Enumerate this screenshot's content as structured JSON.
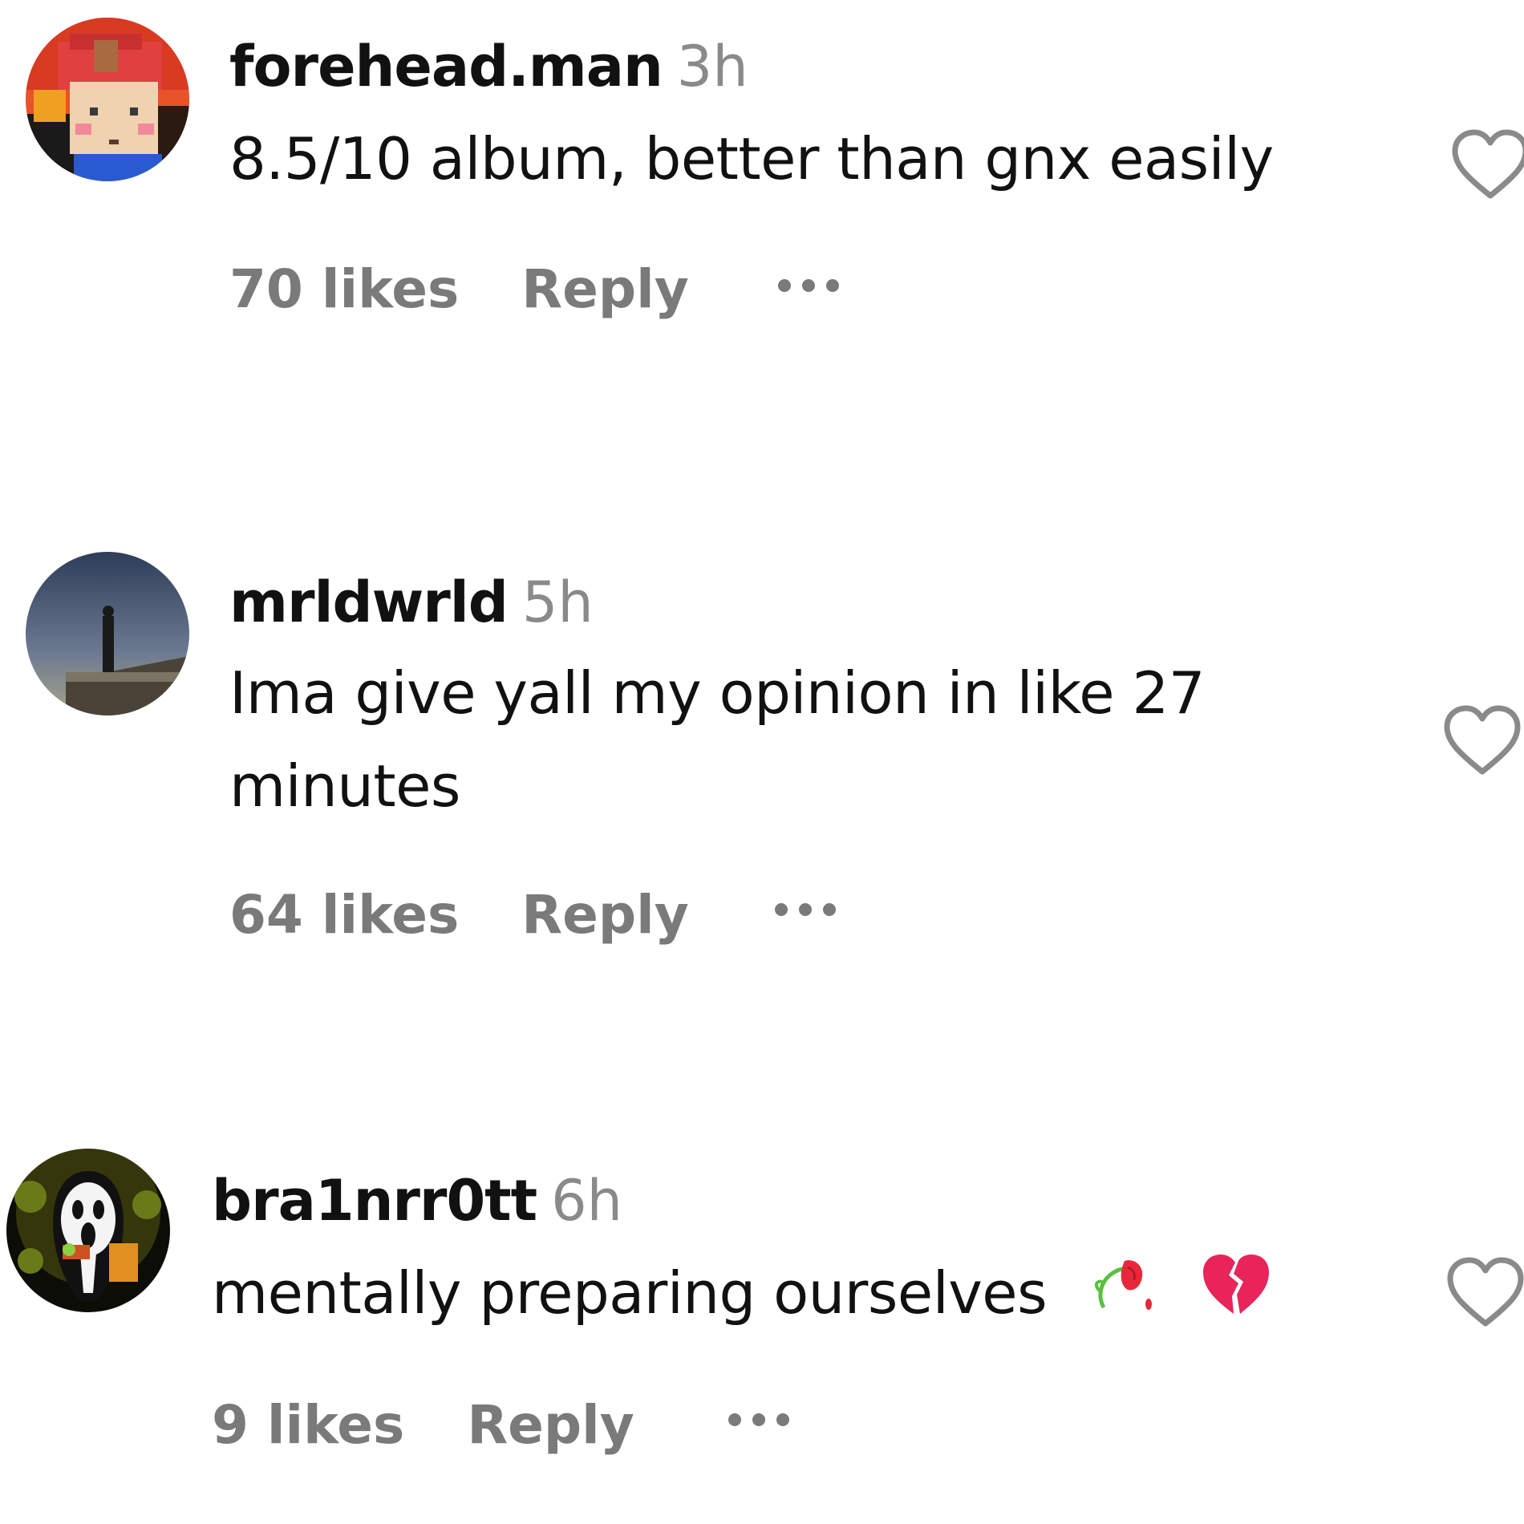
{
  "comments": [
    {
      "username": "forehead.man",
      "time": "3h",
      "text": "8.5/10 album, better than gnx easily",
      "likes": "70 likes",
      "reply": "Reply",
      "avatar_icon": "pixel-character-avatar"
    },
    {
      "username": "mrldwrld",
      "time": "5h",
      "text": "Ima give yall my opinion in like 27 minutes",
      "likes": "64 likes",
      "reply": "Reply",
      "avatar_icon": "silhouette-photo-avatar"
    },
    {
      "username": "bra1nrr0tt",
      "time": "6h",
      "text": "mentally preparing ourselves",
      "emojis": [
        "wilted-rose-emoji",
        "broken-heart-emoji"
      ],
      "likes": "9 likes",
      "reply": "Reply",
      "avatar_icon": "ghostface-avatar"
    }
  ],
  "colors": {
    "text": "#111111",
    "muted": "#7a7a7a",
    "heart_outline": "#8a8a8a",
    "broken_heart": "#e8245a"
  }
}
